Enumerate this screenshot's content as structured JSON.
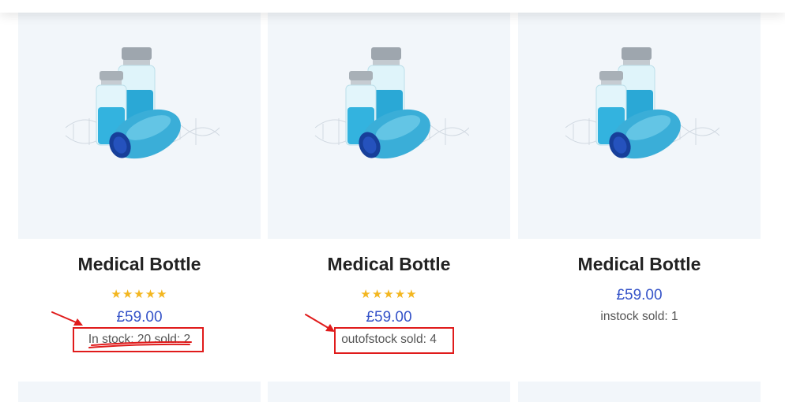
{
  "products": [
    {
      "name": "Medical Bottle",
      "rating": 5,
      "stars": "★★★★★",
      "price": "£59.00",
      "stock": "In stock: 20 sold: 2"
    },
    {
      "name": "Medical Bottle",
      "rating": 5,
      "stars": "★★★★★",
      "price": "£59.00",
      "stock": "outofstock sold: 4"
    },
    {
      "name": "Medical Bottle",
      "rating": null,
      "stars": "",
      "price": "£59.00",
      "stock": "instock sold: 1"
    }
  ],
  "colors": {
    "price": "#3553c8",
    "stars": "#f3b61f",
    "annotation": "#e01b1b",
    "image_bg": "#f2f6fa"
  }
}
